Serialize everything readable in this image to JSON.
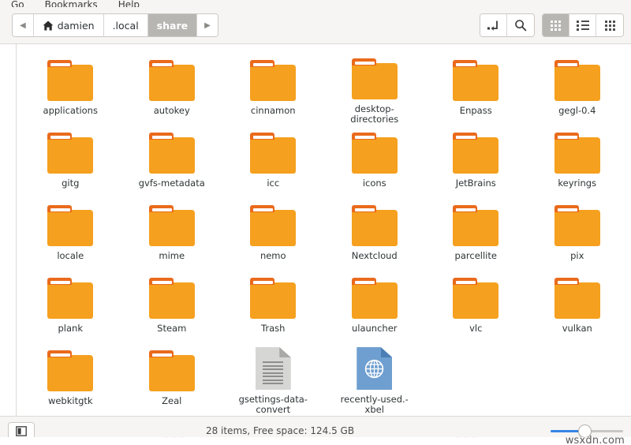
{
  "window": {
    "title": "share",
    "menu": [
      "Go",
      "Bookmarks",
      "Help"
    ]
  },
  "toolbar": {
    "back_arrow": "◀",
    "forward_arrow": "▶",
    "breadcrumbs": [
      {
        "label": "damien",
        "icon": "home-icon",
        "active": false
      },
      {
        "label": ".local",
        "icon": "",
        "active": false
      },
      {
        "label": "share",
        "icon": "",
        "active": true
      }
    ],
    "path_entry_label": "",
    "search_label": "",
    "views": [
      {
        "name": "icon-view",
        "active": true
      },
      {
        "name": "list-view",
        "active": false
      },
      {
        "name": "compact-view",
        "active": false
      }
    ]
  },
  "files": [
    [
      {
        "name": "applications",
        "type": "folder"
      },
      {
        "name": "autokey",
        "type": "folder"
      },
      {
        "name": "cinnamon",
        "type": "folder"
      },
      {
        "name": "desktop-directories",
        "type": "folder"
      },
      {
        "name": "Enpass",
        "type": "folder"
      },
      {
        "name": "gegl-0.4",
        "type": "folder"
      }
    ],
    [
      {
        "name": "gitg",
        "type": "folder"
      },
      {
        "name": "gvfs-metadata",
        "type": "folder"
      },
      {
        "name": "icc",
        "type": "folder"
      },
      {
        "name": "icons",
        "type": "folder"
      },
      {
        "name": "JetBrains",
        "type": "folder"
      },
      {
        "name": "keyrings",
        "type": "folder"
      }
    ],
    [
      {
        "name": "locale",
        "type": "folder"
      },
      {
        "name": "mime",
        "type": "folder"
      },
      {
        "name": "nemo",
        "type": "folder"
      },
      {
        "name": "Nextcloud",
        "type": "folder"
      },
      {
        "name": "parcellite",
        "type": "folder"
      },
      {
        "name": "pix",
        "type": "folder"
      }
    ],
    [
      {
        "name": "plank",
        "type": "folder"
      },
      {
        "name": "Steam",
        "type": "folder"
      },
      {
        "name": "Trash",
        "type": "folder"
      },
      {
        "name": "ulauncher",
        "type": "folder"
      },
      {
        "name": "vlc",
        "type": "folder"
      },
      {
        "name": "vulkan",
        "type": "folder"
      }
    ],
    [
      {
        "name": "webkitgtk",
        "type": "folder"
      },
      {
        "name": "Zeal",
        "type": "folder"
      },
      {
        "name": "gsettings-data-convert",
        "type": "document"
      },
      {
        "name": "recently-used.-xbel",
        "type": "xml"
      }
    ]
  ],
  "statusbar": {
    "summary": "28 items, Free space: 124.5 GB",
    "zoom_percent": 45,
    "watermark": "wsxdn.com"
  },
  "colors": {
    "folder_body": "#f5a01e",
    "folder_tab": "#ea6a1c",
    "accent": "#3584e4",
    "chrome": "#f6f5f4",
    "active_crumb": "#b8b6b2"
  }
}
